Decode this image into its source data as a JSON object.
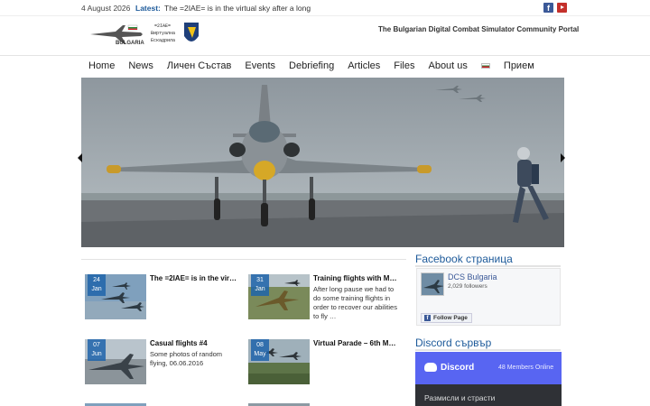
{
  "topbar": {
    "date": "4 August 2026",
    "latest_label": "Latest:",
    "latest_text": "The =2IAE= is in the virtual sky after a long",
    "facebook_icon": "facebook-icon",
    "youtube_icon": "youtube-icon"
  },
  "header": {
    "logo_text_left": "BULGARIA",
    "logo_text_right_1": "=2IAE=",
    "logo_text_right_2": "Виртуална",
    "logo_text_right_3": "Ескадрила",
    "tagline": "The Bulgarian Digital Combat Simulator Community Portal"
  },
  "nav": {
    "items": [
      "Home",
      "News",
      "Личен Състав",
      "Events",
      "Debriefing",
      "Articles",
      "Files",
      "About us",
      "Прием"
    ]
  },
  "posts": [
    {
      "day": "24",
      "month": "Jan",
      "title": "The =2IAE= is in the vir…",
      "excerpt": ""
    },
    {
      "day": "31",
      "month": "Jan",
      "title": "Training flights with M…",
      "excerpt": "After long pause we had to do some training flights in order to recover our abilities to fly …"
    },
    {
      "day": "07",
      "month": "Jun",
      "title": "Casual flights #4",
      "excerpt": "Some photos of random flying, 06.06.2016"
    },
    {
      "day": "08",
      "month": "May",
      "title": "Virtual Parade – 6th M…",
      "excerpt": ""
    }
  ],
  "sidebar": {
    "facebook_title": "Facebook страница",
    "fb_page_name": "DCS Bulgaria",
    "fb_followers": "2,029 followers",
    "fb_follow_label": "Follow Page",
    "discord_title": "Discord сървър",
    "discord_name": "Discord",
    "discord_members": "48 Members Online",
    "discord_channel": "Размисли и страсти"
  },
  "colors": {
    "accent": "#1d5a9a",
    "discord": "#5865f2",
    "facebook": "#3b5998"
  }
}
